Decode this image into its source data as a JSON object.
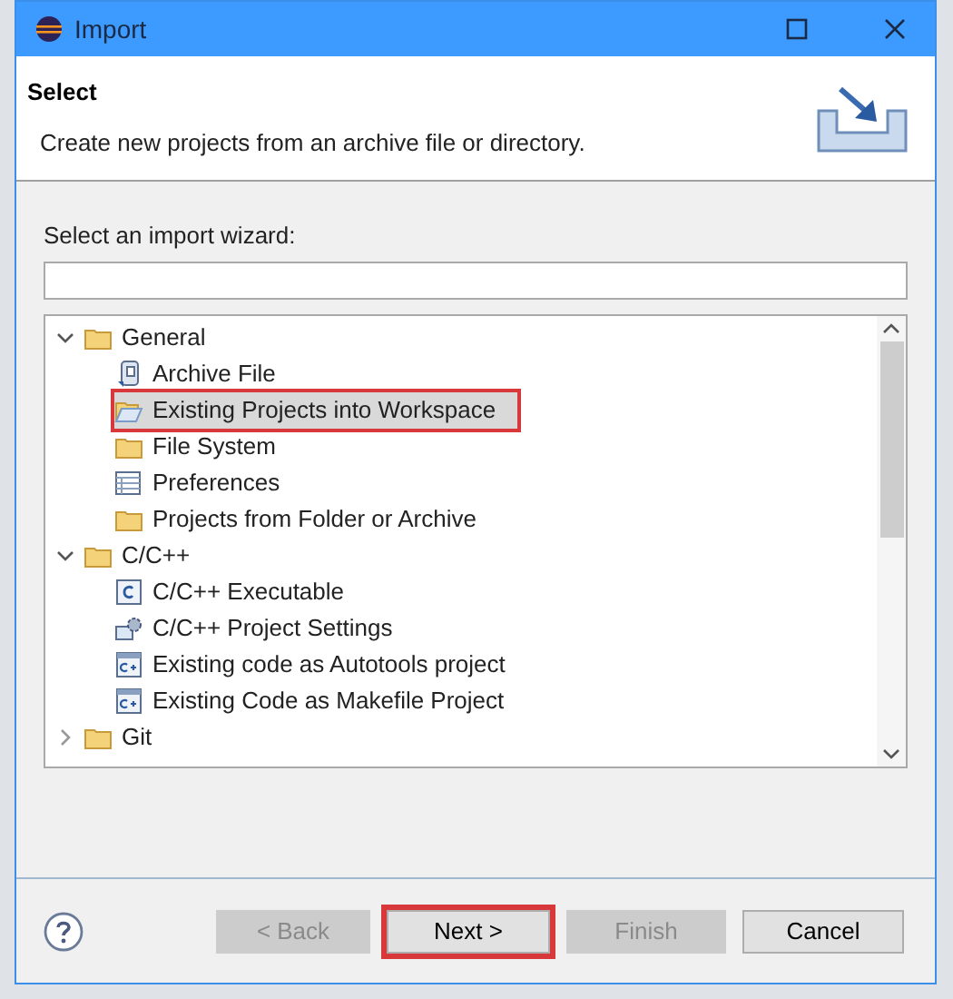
{
  "window": {
    "title": "Import"
  },
  "header": {
    "title": "Select",
    "description": "Create new projects from an archive file or directory."
  },
  "filter": {
    "label": "Select an import wizard:"
  },
  "tree": [
    {
      "label": "General",
      "kind": "folder",
      "expanded": true,
      "children": [
        {
          "label": "Archive File",
          "kind": "archive",
          "selected": false,
          "highlighted": false
        },
        {
          "label": "Existing Projects into Workspace",
          "kind": "open-folder",
          "selected": true,
          "highlighted": true
        },
        {
          "label": "File System",
          "kind": "folder",
          "selected": false,
          "highlighted": false
        },
        {
          "label": "Preferences",
          "kind": "table",
          "selected": false,
          "highlighted": false
        },
        {
          "label": "Projects from Folder or Archive",
          "kind": "folder",
          "selected": false,
          "highlighted": false
        }
      ]
    },
    {
      "label": "C/C++",
      "kind": "folder",
      "expanded": true,
      "children": [
        {
          "label": "C/C++ Executable",
          "kind": "c-file",
          "selected": false,
          "highlighted": false
        },
        {
          "label": "C/C++ Project Settings",
          "kind": "settings",
          "selected": false,
          "highlighted": false
        },
        {
          "label": "Existing code as Autotools project",
          "kind": "cpp-file",
          "selected": false,
          "highlighted": false
        },
        {
          "label": "Existing Code as Makefile Project",
          "kind": "cpp-file",
          "selected": false,
          "highlighted": false
        }
      ]
    },
    {
      "label": "Git",
      "kind": "folder",
      "expanded": false
    }
  ],
  "buttons": [
    {
      "label": "< Back",
      "disabled": true,
      "highlighted": false
    },
    {
      "label": "Next >",
      "disabled": false,
      "highlighted": true
    },
    {
      "label": "Finish",
      "disabled": true,
      "highlighted": false
    },
    {
      "label": "Cancel",
      "disabled": false,
      "highlighted": false
    }
  ]
}
